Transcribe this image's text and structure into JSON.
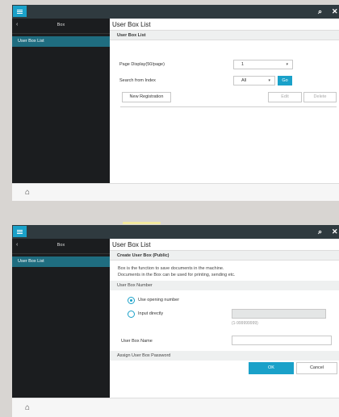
{
  "screen1": {
    "sidebar_title": "Box",
    "sidebar_item": "User Box List",
    "title": "User Box List",
    "subtitle": "User Box List",
    "page_display_label": "Page Display(50/page)",
    "page_display_value": "1",
    "search_label": "Search from Index",
    "search_value": "All",
    "go_label": "Go",
    "new_registration_label": "New Registration",
    "edit_label": "Edit",
    "delete_label": "Delete"
  },
  "screen2": {
    "sidebar_title": "Box",
    "sidebar_item": "User Box List",
    "title": "User Box List",
    "subtitle": "Create User Box (Public)",
    "desc_line1": "Box is the function to save documents in the machine.",
    "desc_line2": "Documents in the Box can be used for printing, sending etc.",
    "user_box_number_header": "User Box Number",
    "use_opening_number_label": "Use opening number",
    "input_directly_label": "Input directly",
    "input_hint": "(1-999999999)",
    "user_box_name_label": "User Box Name",
    "assign_password_header": "Assign User Box Password",
    "ok_label": "OK",
    "cancel_label": "Cancel"
  },
  "colors": {
    "accent": "#1aa1c9",
    "topbar": "#2f3a3f",
    "sidebar": "#1b1d1f",
    "sidebar_selected": "#1f6d80"
  },
  "icons": {
    "menu": "hamburger-icon",
    "search": "search-icon",
    "close": "close-icon",
    "back": "chevron-left-icon",
    "home": "home-icon"
  }
}
